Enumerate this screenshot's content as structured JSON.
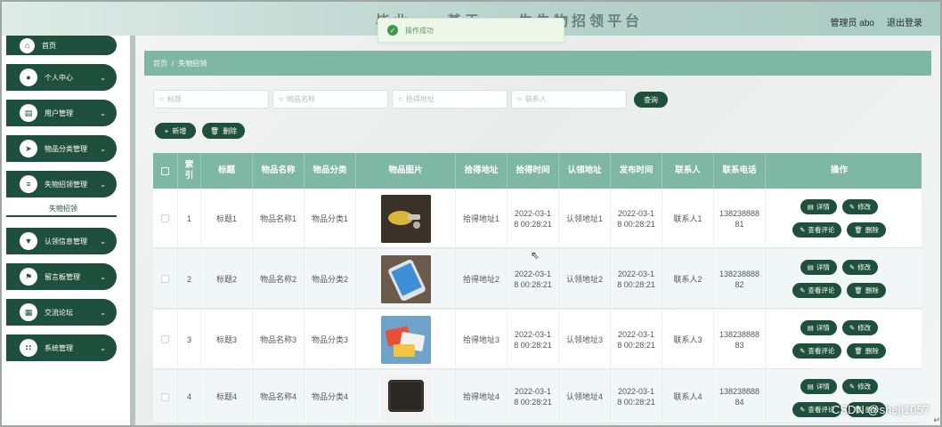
{
  "header": {
    "title": "毕业……基于……生失物招领平台",
    "user": "管理员 abo",
    "logout": "退出登录"
  },
  "toast": {
    "text": "操作成功"
  },
  "sidebar": {
    "items": [
      {
        "label": "首页",
        "icon": "home-icon",
        "glyph": "⌂"
      },
      {
        "label": "个人中心",
        "icon": "user-icon",
        "glyph": "●"
      },
      {
        "label": "用户管理",
        "icon": "users-icon",
        "glyph": "▤"
      },
      {
        "label": "物品分类管理",
        "icon": "send-icon",
        "glyph": "➤"
      },
      {
        "label": "失物招领管理",
        "icon": "sliders-icon",
        "glyph": "≡"
      },
      {
        "label": "认领信息管理",
        "icon": "shield-icon",
        "glyph": "▼"
      },
      {
        "label": "留言板管理",
        "icon": "flag-icon",
        "glyph": "⚑"
      },
      {
        "label": "交流论坛",
        "icon": "grid-icon",
        "glyph": "▦"
      },
      {
        "label": "系统管理",
        "icon": "apps-icon",
        "glyph": "∷"
      }
    ],
    "submenu": "失物招领",
    "chevron": "⌄"
  },
  "breadcrumb": {
    "home": "首页",
    "sep": "/",
    "current": "失物招领"
  },
  "search": {
    "title_ph": "标题",
    "name_ph": "物品名称",
    "addr_ph": "拾得地址",
    "contact_ph": "联系人",
    "query": "查询"
  },
  "actions": {
    "add": "新增",
    "delete": "删除"
  },
  "table": {
    "headers": {
      "index": "索\n引",
      "title": "标题",
      "name": "物品名称",
      "category": "物品分类",
      "image": "物品图片",
      "found_addr": "拾得地址",
      "found_time": "拾得时间",
      "claim_addr": "认领地址",
      "publish_time": "发布时间",
      "contact": "联系人",
      "phone": "联系电话",
      "ops": "操作"
    },
    "rows": [
      {
        "index": "1",
        "title": "标题1",
        "name": "物品名称1",
        "category": "物品分类1",
        "found_addr": "拾得地址1",
        "found_time": "2022-03-1\n8 00:28:21",
        "claim_addr": "认领地址1",
        "publish_time": "2022-03-1\n8 00:28:21",
        "contact": "联系人1",
        "phone": "138238888\n81"
      },
      {
        "index": "2",
        "title": "标题2",
        "name": "物品名称2",
        "category": "物品分类2",
        "found_addr": "拾得地址2",
        "found_time": "2022-03-1\n8 00:28:21",
        "claim_addr": "认领地址2",
        "publish_time": "2022-03-1\n8 00:28:21",
        "contact": "联系人2",
        "phone": "138238888\n82"
      },
      {
        "index": "3",
        "title": "标题3",
        "name": "物品名称3",
        "category": "物品分类3",
        "found_addr": "拾得地址3",
        "found_time": "2022-03-1\n8 00:28:21",
        "claim_addr": "认领地址3",
        "publish_time": "2022-03-1\n8 00:28:21",
        "contact": "联系人3",
        "phone": "138238888\n83"
      },
      {
        "index": "4",
        "title": "标题4",
        "name": "物品名称4",
        "category": "物品分类4",
        "found_addr": "拾得地址4",
        "found_time": "2022-03-1\n8 00:28:21",
        "claim_addr": "认领地址4",
        "publish_time": "2022-03-1\n8 00:28:21",
        "contact": "联系人4",
        "phone": "138238888\n84"
      }
    ],
    "op_labels": {
      "detail": "详情",
      "edit": "修改",
      "comments": "查看评论",
      "delete": "删除"
    }
  },
  "watermark": "CSDN @shejì1057",
  "colors": {
    "accent": "#1f4f3d",
    "header_teal": "#7fb7a5",
    "toast_green": "#3c9a4a"
  }
}
